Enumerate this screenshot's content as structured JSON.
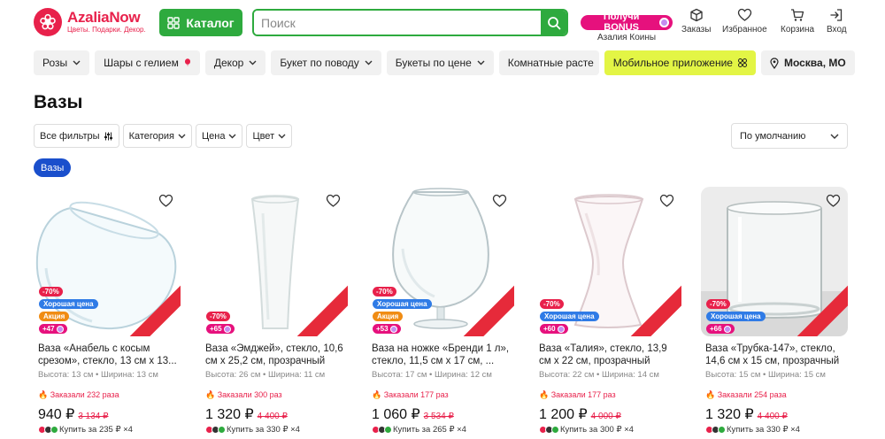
{
  "brand": {
    "name": "AzaliaNow",
    "tagline": "Цветы. Подарки. Декор."
  },
  "catalog_label": "Каталог",
  "search": {
    "placeholder": "Поиск"
  },
  "bonus": {
    "label": "Получи BONUS",
    "sub": "Азалия Коины"
  },
  "nav": {
    "orders": "Заказы",
    "favorites": "Избранное",
    "cart": "Корзина",
    "login": "Вход"
  },
  "categories": {
    "roses": "Розы",
    "balloons": "Шары с гелием",
    "decor": "Декор",
    "occasion": "Букет по поводу",
    "by_price": "Букеты по цене",
    "indoor": "Комнатные расте",
    "app": "Мобильное приложение",
    "location": "Москва, МО"
  },
  "page_title": "Вазы",
  "filters": {
    "all": "Все фильтры",
    "category": "Категория",
    "price": "Цена",
    "color": "Цвет"
  },
  "sort": "По умолчанию",
  "active_chip": "Вазы",
  "colors": {
    "green": "#2eaa3e",
    "pink": "#e8214b",
    "blue": "#1a4fcc",
    "lime": "#e3f545"
  },
  "products": [
    {
      "discount": "-70%",
      "good": "Хорошая цена",
      "promo": "Акция",
      "points": "+47",
      "name": "Ваза «Анабель с косым срезом», стекло, 13 см х 13...",
      "dims": "Высота: 13 см • Ширина: 13 см",
      "sold": "Заказали 232 раза",
      "price": "940 ₽",
      "old_price": "3 134 ₽",
      "split": "Купить за 235 ₽ ×4"
    },
    {
      "discount": "-70%",
      "good": "",
      "promo": "",
      "points": "+65",
      "name": "Ваза «Эмджей», стекло, 10,6 см х 25,2 см, прозрачный",
      "dims": "Высота: 26 см • Ширина: 11 см",
      "sold": "Заказали 300 раз",
      "price": "1 320 ₽",
      "old_price": "4 400 ₽",
      "split": "Купить за 330 ₽ ×4"
    },
    {
      "discount": "-70%",
      "good": "Хорошая цена",
      "promo": "Акция",
      "points": "+53",
      "name": "Ваза на ножке «Бренди 1 л», стекло, 11,5 см х 17 см, ...",
      "dims": "Высота: 17 см • Ширина: 12 см",
      "sold": "Заказали 177 раз",
      "price": "1 060 ₽",
      "old_price": "3 534 ₽",
      "split": "Купить за 265 ₽ ×4"
    },
    {
      "discount": "-70%",
      "good": "Хорошая цена",
      "promo": "",
      "points": "+60",
      "name": "Ваза «Талия», стекло, 13,9 см х 22 см, прозрачный",
      "dims": "Высота: 22 см • Ширина: 14 см",
      "sold": "Заказали 177 раз",
      "price": "1 200 ₽",
      "old_price": "4 000 ₽",
      "split": "Купить за 300 ₽ ×4"
    },
    {
      "discount": "-70%",
      "good": "Хорошая цена",
      "promo": "",
      "points": "+66",
      "name": "Ваза «Трубка-147», стекло, 14,6 см х 15 см, прозрачный",
      "dims": "Высота: 15 см • Ширина: 15 см",
      "sold": "Заказали 254 раза",
      "price": "1 320 ₽",
      "old_price": "4 400 ₽",
      "split": "Купить за 330 ₽ ×4"
    }
  ]
}
